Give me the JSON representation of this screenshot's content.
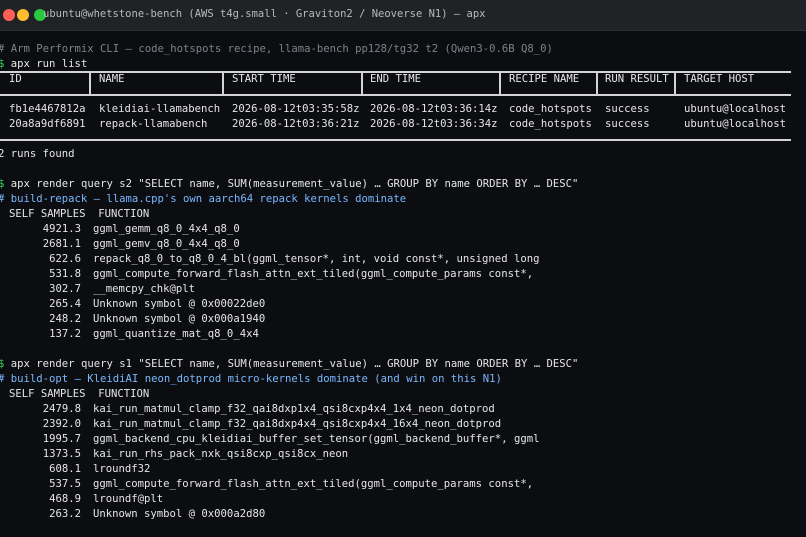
{
  "window": {
    "title": "ubuntu@whetstone-bench (AWS t4g.small · Graviton2 / Neoverse N1) — apx"
  },
  "header_comment": "# Arm Performix CLI — code_hotspots recipe, llama-bench pp128/tg32 t2 (Qwen3-0.6B Q8_0)",
  "cmd_run_list": {
    "prompt": "$",
    "command": "apx run list"
  },
  "run_table": {
    "columns": [
      "ID",
      "NAME",
      "START TIME",
      "END TIME",
      "RECIPE NAME",
      "RUN RESULT",
      "TARGET HOST"
    ],
    "rows": [
      [
        "fb1e4467812a",
        "kleidiai-llamabench",
        "2026-08-12t03:35:58z",
        "2026-08-12t03:36:14z",
        "code_hotspots",
        "success",
        "ubuntu@localhost"
      ],
      [
        "20a8a9df6891",
        "repack-llamabench",
        "2026-08-12t03:36:21z",
        "2026-08-12t03:36:34z",
        "code_hotspots",
        "success",
        "ubuntu@localhost"
      ]
    ]
  },
  "runs_found": "2 runs found",
  "query1": {
    "prompt": "$",
    "command": "apx render query s2 \"SELECT name, SUM(measurement_value) … GROUP BY name ORDER BY … DESC\"",
    "comment": "# build-repack — llama.cpp's own aarch64 repack kernels dominate",
    "header": "SELF SAMPLES  FUNCTION",
    "rows": [
      {
        "samples": "4921.3",
        "function": "ggml_gemm_q8_0_4x4_q8_0"
      },
      {
        "samples": "2681.1",
        "function": "ggml_gemv_q8_0_4x4_q8_0"
      },
      {
        "samples": "622.6",
        "function": "repack_q8_0_to_q8_0_4_bl(ggml_tensor*, int, void const*, unsigned long"
      },
      {
        "samples": "531.8",
        "function": "ggml_compute_forward_flash_attn_ext_tiled(ggml_compute_params const*,"
      },
      {
        "samples": "302.7",
        "function": "__memcpy_chk@plt"
      },
      {
        "samples": "265.4",
        "function": "Unknown symbol @ 0x00022de0"
      },
      {
        "samples": "248.2",
        "function": "Unknown symbol @ 0x000a1940"
      },
      {
        "samples": "137.2",
        "function": "ggml_quantize_mat_q8_0_4x4"
      }
    ]
  },
  "query2": {
    "prompt": "$",
    "command": "apx render query s1 \"SELECT name, SUM(measurement_value) … GROUP BY name ORDER BY … DESC\"",
    "comment": "# build-opt — KleidiAI neon_dotprod micro-kernels dominate (and win on this N1)",
    "header": "SELF SAMPLES  FUNCTION",
    "rows": [
      {
        "samples": "2479.8",
        "function": "kai_run_matmul_clamp_f32_qai8dxp1x4_qsi8cxp4x4_1x4_neon_dotprod"
      },
      {
        "samples": "2392.0",
        "function": "kai_run_matmul_clamp_f32_qai8dxp4x4_qsi8cxp4x4_16x4_neon_dotprod"
      },
      {
        "samples": "1995.7",
        "function": "ggml_backend_cpu_kleidiai_buffer_set_tensor(ggml_backend_buffer*, ggml"
      },
      {
        "samples": "1373.5",
        "function": "kai_run_rhs_pack_nxk_qsi8cxp_qsi8cx_neon"
      },
      {
        "samples": "608.1",
        "function": "lroundf32"
      },
      {
        "samples": "537.5",
        "function": "ggml_compute_forward_flash_attn_ext_tiled(ggml_compute_params const*,"
      },
      {
        "samples": "468.9",
        "function": "lroundf@plt"
      },
      {
        "samples": "263.2",
        "function": "Unknown symbol @ 0x000a2d80"
      }
    ]
  }
}
